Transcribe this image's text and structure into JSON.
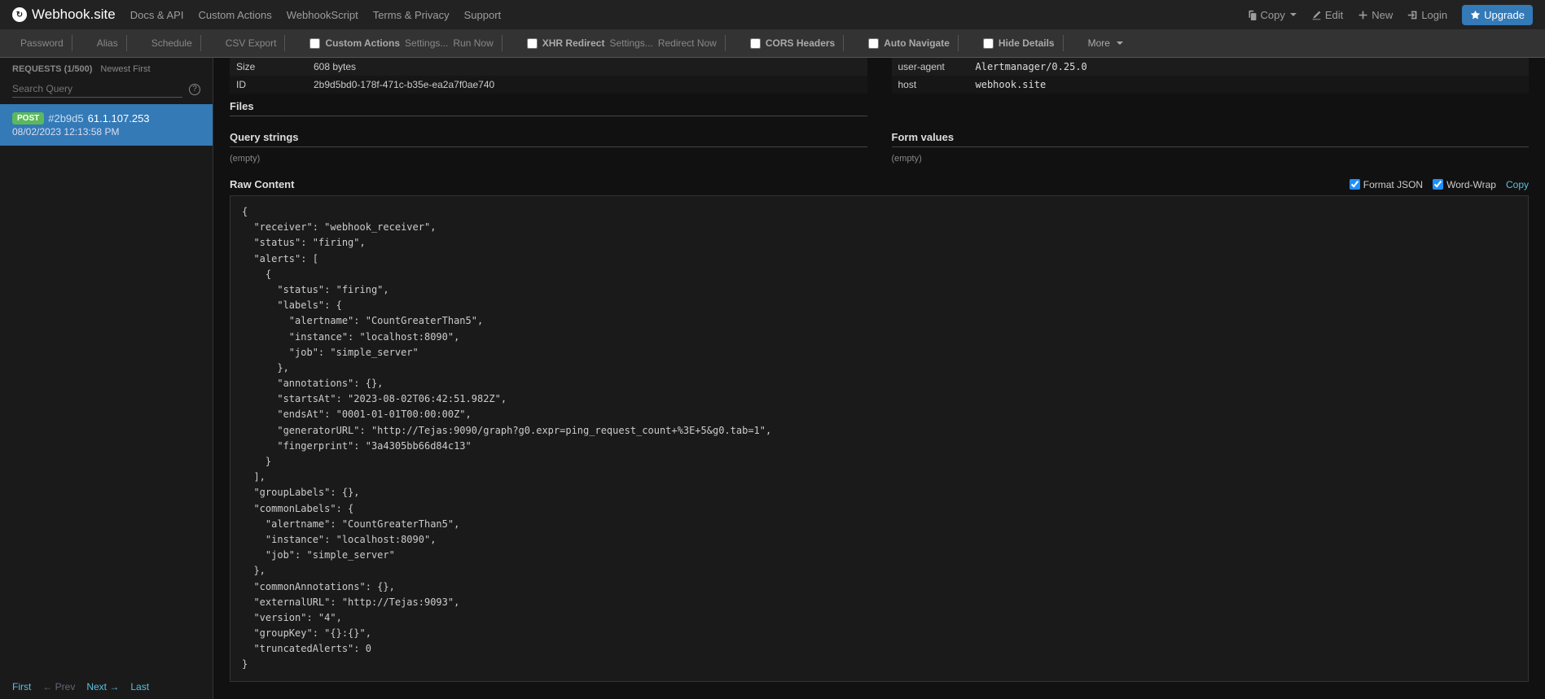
{
  "brand": "Webhook.site",
  "nav": {
    "links": [
      "Docs & API",
      "Custom Actions",
      "WebhookScript",
      "Terms & Privacy",
      "Support"
    ],
    "copy": "Copy",
    "edit": "Edit",
    "new": "New",
    "login": "Login",
    "upgrade": "Upgrade"
  },
  "subbar": {
    "password": "Password",
    "alias": "Alias",
    "schedule": "Schedule",
    "csv": "CSV Export",
    "custom_actions": "Custom Actions",
    "settings": "Settings...",
    "run_now": "Run Now",
    "xhr": "XHR Redirect",
    "redirect_now": "Redirect Now",
    "cors": "CORS Headers",
    "auto_nav": "Auto Navigate",
    "hide_details": "Hide Details",
    "more": "More"
  },
  "sidebar": {
    "header_title": "REQUESTS (1/500)",
    "newest": "Newest First",
    "search_placeholder": "Search Query",
    "request": {
      "method": "POST",
      "hash": "#2b9d5",
      "ip": "61.1.107.253",
      "date": "08/02/2023 12:13:58 PM"
    },
    "pagination": {
      "first": "First",
      "prev": "← Prev",
      "next": "Next →",
      "last": "Last"
    }
  },
  "details": {
    "left": [
      {
        "k": "Size",
        "v": "608 bytes"
      },
      {
        "k": "ID",
        "v": "2b9d5bd0-178f-471c-b35e-ea2a7f0ae740"
      }
    ],
    "right": [
      {
        "k": "user-agent",
        "v": "Alertmanager/0.25.0"
      },
      {
        "k": "host",
        "v": "webhook.site"
      }
    ],
    "files_title": "Files",
    "qs_title": "Query strings",
    "form_title": "Form values",
    "empty": "(empty)"
  },
  "raw": {
    "title": "Raw Content",
    "format_json": "Format JSON",
    "word_wrap": "Word-Wrap",
    "copy": "Copy",
    "body": "{\n  \"receiver\": \"webhook_receiver\",\n  \"status\": \"firing\",\n  \"alerts\": [\n    {\n      \"status\": \"firing\",\n      \"labels\": {\n        \"alertname\": \"CountGreaterThan5\",\n        \"instance\": \"localhost:8090\",\n        \"job\": \"simple_server\"\n      },\n      \"annotations\": {},\n      \"startsAt\": \"2023-08-02T06:42:51.982Z\",\n      \"endsAt\": \"0001-01-01T00:00:00Z\",\n      \"generatorURL\": \"http://Tejas:9090/graph?g0.expr=ping_request_count+%3E+5&g0.tab=1\",\n      \"fingerprint\": \"3a4305bb66d84c13\"\n    }\n  ],\n  \"groupLabels\": {},\n  \"commonLabels\": {\n    \"alertname\": \"CountGreaterThan5\",\n    \"instance\": \"localhost:8090\",\n    \"job\": \"simple_server\"\n  },\n  \"commonAnnotations\": {},\n  \"externalURL\": \"http://Tejas:9093\",\n  \"version\": \"4\",\n  \"groupKey\": \"{}:{}\",\n  \"truncatedAlerts\": 0\n}"
  }
}
